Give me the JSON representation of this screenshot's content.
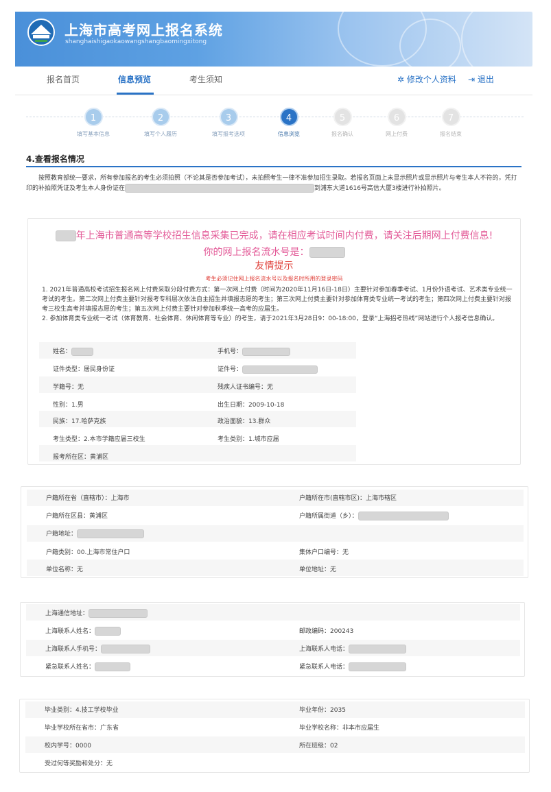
{
  "header": {
    "title": "上海市高考网上报名系统",
    "subtitle": "shanghaishigaokaowangshangbaomingxitong"
  },
  "nav": {
    "tabs": [
      "报名首页",
      "信息预览",
      "考生须知"
    ],
    "edit_profile": "修改个人资料",
    "logout": "退出"
  },
  "steps": [
    {
      "num": "1",
      "label": "填写基本信息"
    },
    {
      "num": "2",
      "label": "填写个人履历"
    },
    {
      "num": "3",
      "label": "填写报考选项"
    },
    {
      "num": "4",
      "label": "信息浏览"
    },
    {
      "num": "5",
      "label": "报名确认"
    },
    {
      "num": "6",
      "label": "网上付费"
    },
    {
      "num": "7",
      "label": "报名结束"
    }
  ],
  "section": {
    "title": "4.查看报名情况",
    "notice_a": "按照教育部统一要求，所有参加报名的考生必须拍照（不论其是否参加考试），未拍照考生一律不准参加招生录取。若报名页面上未显示照片或显示照片与考生本人不符的，凭打印的补拍照凭证及考生本人身份证在",
    "notice_b": "到浦东大道1616号高信大厦3楼进行补拍照片。"
  },
  "highlight": {
    "title": "年上海市普通高等学校招生信息采集已完成，请在相应考试时间内付费，请关注后期网上付费信息!",
    "serial": "你的网上报名流水号是：",
    "warm": "友情提示",
    "warm_note": "考生必须记住网上报名流水号以及报名时所用的登录密码",
    "rule1": "1. 2021年普通高校考试招生报名网上付费采取分段付费方式：第一次网上付费（时间为2020年11月16日-18日）主要针对参加春季考试、1月份外语考试、艺术类专业统一考试的考生。第二次网上付费主要针对报考专科层次依法自主招生并填报志愿的考生；第三次网上付费主要针对参加体育类专业统一考试的考生；第四次网上付费主要针对报考三校生高考并填报志愿的考生；第五次网上付费主要针对参加秋季统一高考的应届生。",
    "rule2": "2. 参加体育类专业统一考试（体育教育、社会体育、休闲体育等专业）的考生，请于2021年3月28日9：00-18:00，登录“上海招考热线”网站进行个人报考信息确认。"
  },
  "basic": {
    "name_label": "姓名：",
    "phone_label": "手机号：",
    "idtype_label": "证件类型：",
    "idtype": "居民身份证",
    "idno_label": "证件号：",
    "studentno_label": "学籍号：",
    "studentno": "无",
    "disability_label": "残疾人证书编号：",
    "disability": "无",
    "gender_label": "性别：",
    "gender": "1.男",
    "birth_label": "出生日期：",
    "birth": "2009-10-18",
    "ethnic_label": "民族：",
    "ethnic": "17.哈萨克族",
    "political_label": "政治面貌：",
    "political": "13.群众",
    "examtype_label": "考生类型：",
    "examtype": "2.本市学籍应届三校生",
    "examcat_label": "考生类别：",
    "examcat": "1.城市应届",
    "district_label": "报考所在区：",
    "district": "黄浦区"
  },
  "household": {
    "prov_label": "户籍所在省（直辖市）：",
    "prov": "上海市",
    "city_label": "户籍所在市(直辖市区)：",
    "city": "上海市辖区",
    "county_label": "户籍所在区县：",
    "county": "黄浦区",
    "street_label": "户籍所属街道（乡）：",
    "addr_label": "户籍地址：",
    "type_label": "户籍类别：",
    "type": "00.上海市常住户口",
    "collective_label": "集体户口编号：",
    "collective": "无",
    "unit_label": "单位名称：",
    "unit": "无",
    "unitaddr_label": "单位地址：",
    "unitaddr": "无"
  },
  "contact": {
    "mail_label": "上海通信地址：",
    "person_label": "上海联系人姓名：",
    "postcode_label": "邮政编码：",
    "postcode": "200243",
    "mobile_label": "上海联系人手机号：",
    "tel_label": "上海联系人电话：",
    "emer_label": "紧急联系人姓名：",
    "emer_tel_label": "紧急联系人电话："
  },
  "graduation": {
    "gtype_label": "毕业类别：",
    "gtype": "4.技工学校毕业",
    "gyear_label": "毕业年份：",
    "gyear": "2035",
    "gprov_label": "毕业学校所在省市：",
    "gprov": "广东省",
    "gschool_label": "毕业学校名称：",
    "gschool": "非本市应届生",
    "inno_label": "校内学号：",
    "inno": "0000",
    "class_label": "所在班级：",
    "class": "02",
    "award_label": "受过何等奖励和处分：",
    "award": "无"
  }
}
